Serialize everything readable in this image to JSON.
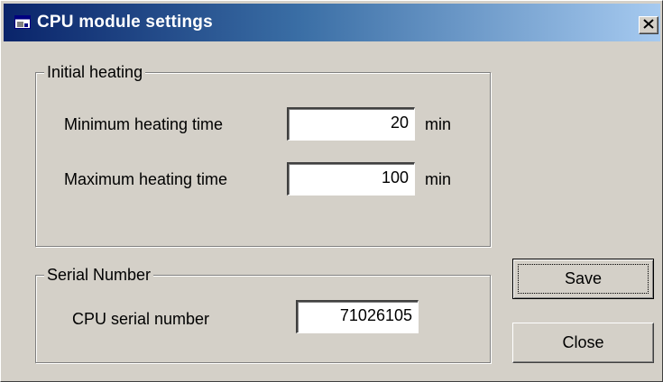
{
  "window": {
    "title": "CPU module settings",
    "close_glyph": "×",
    "icon": "app-window-icon"
  },
  "initial_heating": {
    "legend": "Initial heating",
    "min_label": "Minimum heating time",
    "min_value": "20",
    "min_unit": "min",
    "max_label": "Maximum heating time",
    "max_value": "100",
    "max_unit": "min"
  },
  "serial": {
    "legend": "Serial Number",
    "cpu_label": "CPU serial number",
    "cpu_value": "71026105"
  },
  "buttons": {
    "save_label": "Save",
    "close_label": "Close"
  }
}
